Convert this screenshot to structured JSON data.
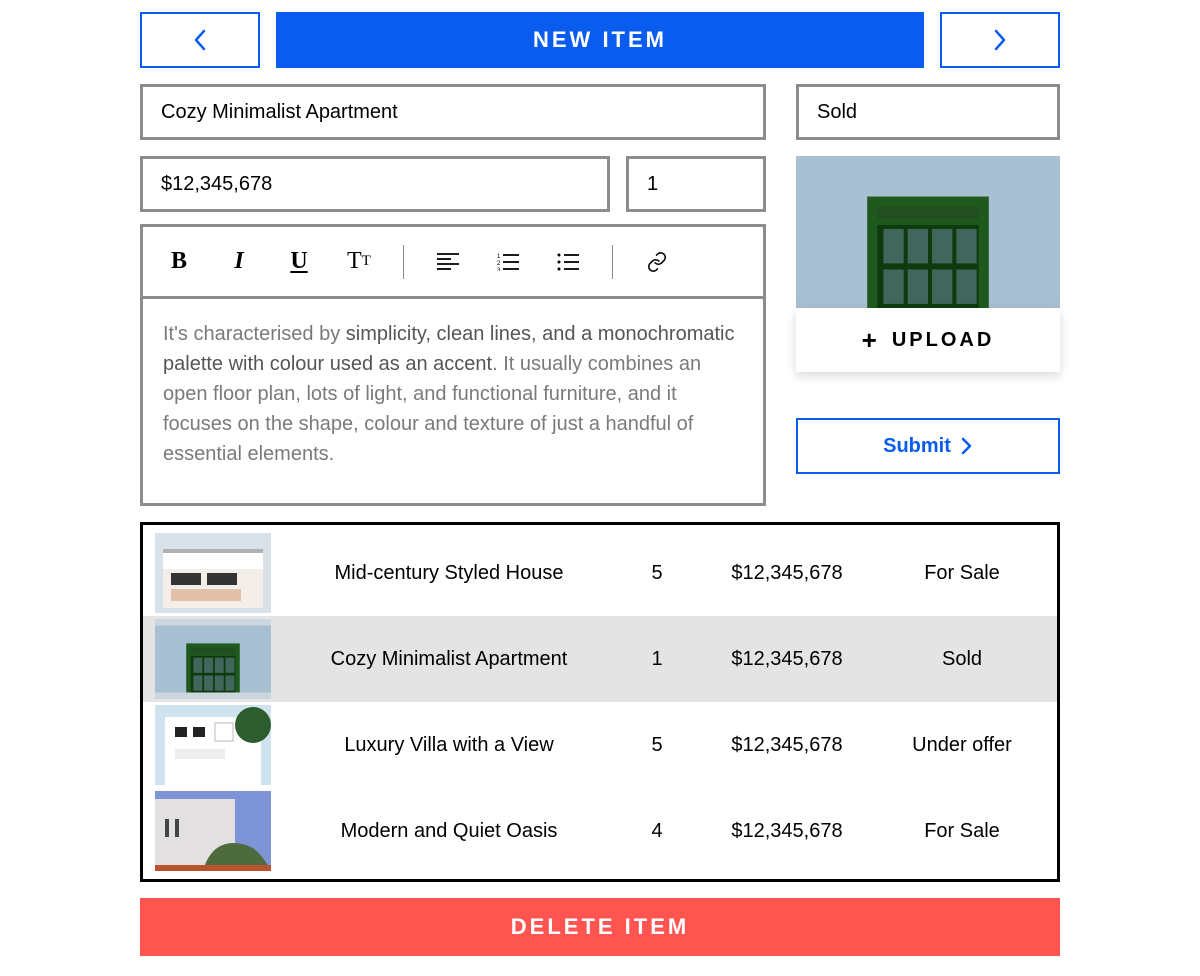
{
  "topnav": {
    "new_item": "New Item"
  },
  "form": {
    "title": "Cozy Minimalist Apartment",
    "price": "$12,345,678",
    "quantity": "1",
    "status": "Sold",
    "description_prefix": "It's characterised by ",
    "description_strong": "simplicity, clean lines, and a monochromatic palette with colour used as an accent",
    "description_suffix": ". It usually combines an open floor plan, lots of light, and functional furniture, and it focuses on the shape, colour and texture of just a handful of essential elements."
  },
  "upload_label": "UPLOAD",
  "submit_label": "Submit",
  "delete_label": "Delete Item",
  "listing": [
    {
      "name": "Mid-century Styled House",
      "qty": "5",
      "price": "$12,345,678",
      "status": "For Sale",
      "selected": false,
      "thumb": "house1"
    },
    {
      "name": "Cozy Minimalist Apartment",
      "qty": "1",
      "price": "$12,345,678",
      "status": "Sold",
      "selected": true,
      "thumb": "tower"
    },
    {
      "name": "Luxury Villa with a View",
      "qty": "5",
      "price": "$12,345,678",
      "status": "Under offer",
      "selected": false,
      "thumb": "villa"
    },
    {
      "name": "Modern and Quiet Oasis",
      "qty": "4",
      "price": "$12,345,678",
      "status": "For Sale",
      "selected": false,
      "thumb": "oasis"
    }
  ]
}
